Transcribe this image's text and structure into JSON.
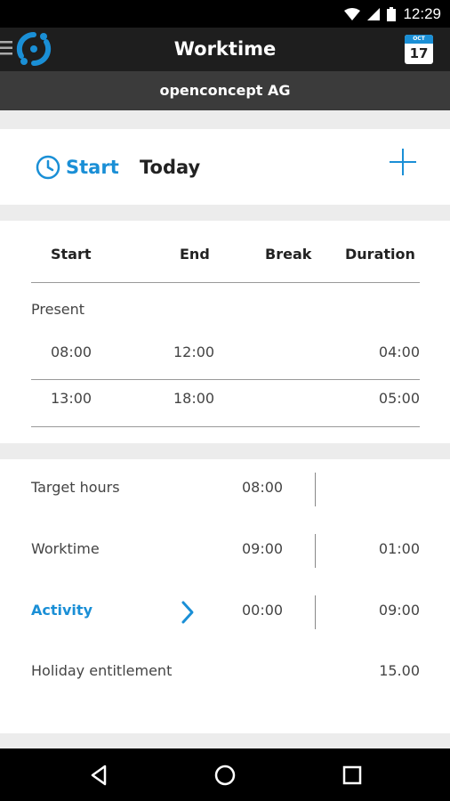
{
  "status_bar": {
    "time": "12:29"
  },
  "app_bar": {
    "title": "Worktime",
    "calendar": {
      "month": "OCT",
      "day": "17"
    }
  },
  "company": {
    "name": "openconcept AG"
  },
  "start_section": {
    "start_label": "Start",
    "today_label": "Today"
  },
  "entries_table": {
    "columns": [
      "Start",
      "End",
      "Break",
      "Duration"
    ],
    "group_label": "Present",
    "rows": [
      {
        "start": "08:00",
        "end": "12:00",
        "break": "",
        "duration": "04:00"
      },
      {
        "start": "13:00",
        "end": "18:00",
        "break": "",
        "duration": "05:00"
      }
    ]
  },
  "summary": {
    "target_hours": {
      "label": "Target hours",
      "value": "08:00",
      "diff": ""
    },
    "worktime": {
      "label": "Worktime",
      "value": "09:00",
      "diff": "01:00"
    },
    "activity": {
      "label": "Activity",
      "value": "00:00",
      "diff": "09:00"
    },
    "holiday": {
      "label": "Holiday entitlement",
      "value": "15.00"
    }
  },
  "colors": {
    "accent": "#1a8fd6",
    "appbar": "#1e1e1e",
    "companybar": "#3b3b3b"
  }
}
